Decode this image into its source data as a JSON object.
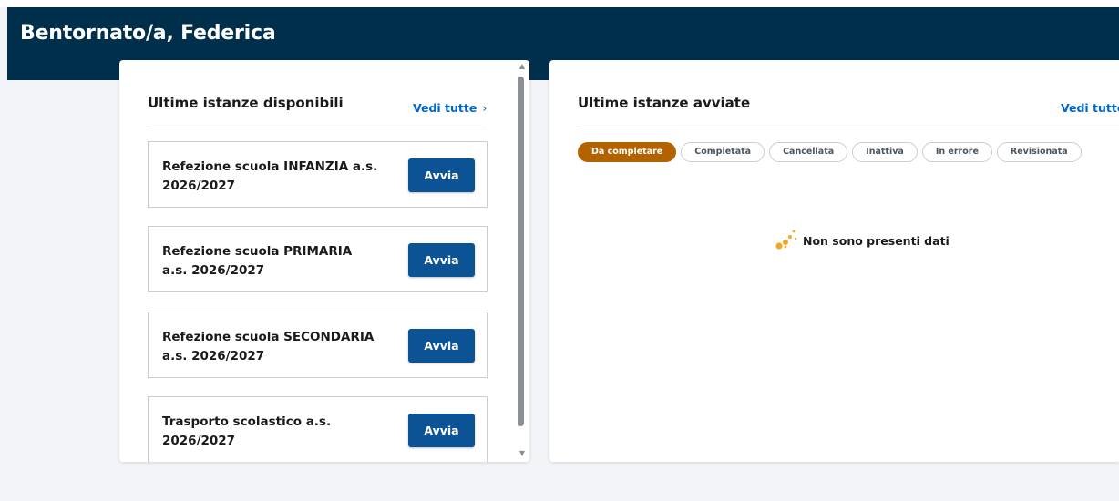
{
  "header": {
    "welcome": "Bentornato/a, Federica"
  },
  "available": {
    "title": "Ultime istanze disponibili",
    "see_all": "Vedi tutte",
    "items": [
      {
        "title": "Refezione scuola INFANZIA a.s. 2026/2027",
        "button": "Avvia"
      },
      {
        "title": "Refezione scuola PRIMARIA a.s. 2026/2027",
        "button": "Avvia"
      },
      {
        "title": "Refezione scuola SECONDARIA a.s. 2026/2027",
        "button": "Avvia"
      },
      {
        "title": "Trasporto scolastico a.s. 2026/2027",
        "button": "Avvia"
      }
    ]
  },
  "started": {
    "title": "Ultime istanze avviate",
    "see_all": "Vedi tutte",
    "filters": [
      "Da completare",
      "Completata",
      "Cancellata",
      "Inattiva",
      "In errore",
      "Revisionata"
    ],
    "active_filter": "Da completare",
    "empty_message": "Non sono presenti dati"
  },
  "icons": {
    "see_all_chevron": "chevron-right-icon",
    "empty": "orange-dots-icon",
    "scroll_up": "scroll-up-arrow-icon",
    "scroll_down": "scroll-down-arrow-icon"
  },
  "colors": {
    "header_bg": "#002f4c",
    "primary_button": "#0b5394",
    "link": "#0066cc",
    "active_chip": "#b36200",
    "empty_icon": "#f5a623",
    "page_bg": "#f2f4f7"
  }
}
